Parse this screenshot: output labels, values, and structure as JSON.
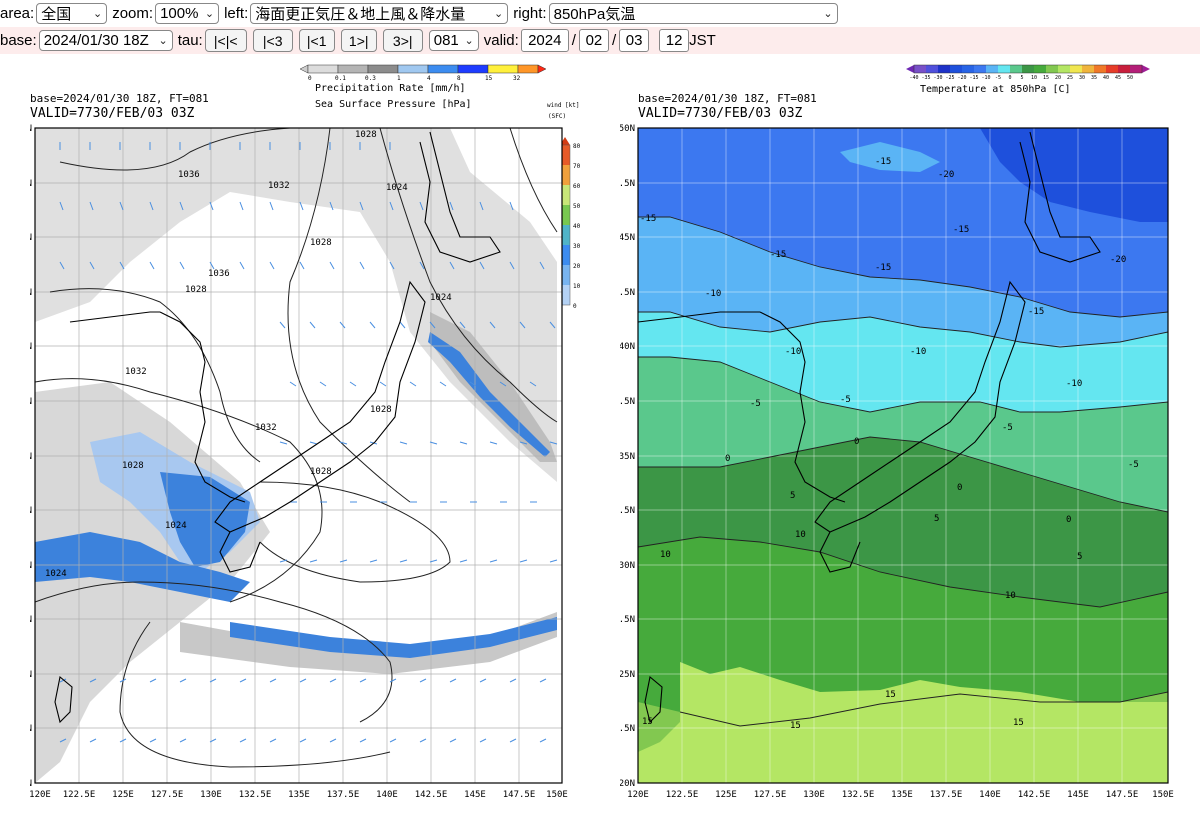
{
  "toolbar": {
    "area_label": "area:",
    "area_value": "全国",
    "zoom_label": "zoom:",
    "zoom_value": "100%",
    "left_label": "left:",
    "left_value": "海面更正気圧＆地上風＆降水量",
    "right_label": "right:",
    "right_value": "850hPa気温"
  },
  "nav": {
    "base_label": "base:",
    "base_value": "2024/01/30 18Z",
    "tau_label": "tau:",
    "btn_first": "|<|<",
    "btn_back3": "|<3",
    "btn_back1": "|<1",
    "btn_fwd1": "1>|",
    "btn_fwd3": "3>|",
    "tau_value": "081",
    "valid_label": "valid:",
    "valid_year": "2024",
    "valid_month": "02",
    "valid_day": "03",
    "valid_hour": "12",
    "slash": "/",
    "jst_label": "JST"
  },
  "left_map": {
    "header_line1": "base=2024/01/30 18Z, FT=081",
    "header_line2": "VALID=7730/FEB/03 03Z",
    "legend_title1": "Precipitation Rate [mm/h]",
    "legend_title2": "Sea Surface Pressure [hPa]",
    "precip_ticks": [
      "0",
      "0.1",
      "0.3",
      "1",
      "4",
      "8",
      "15",
      "32"
    ],
    "wind_title1": "wind [kt]",
    "wind_title2": "(SFC)",
    "wind_ticks": [
      "80",
      "70",
      "60",
      "50",
      "40",
      "30",
      "20",
      "10",
      "0"
    ],
    "isobar_labels": [
      "1028",
      "1036",
      "1032",
      "1024",
      "1028",
      "1036",
      "1028",
      "1024",
      "1032",
      "1032",
      "1028",
      "1028",
      "1028",
      "1024",
      "1024"
    ],
    "colors": {
      "sea": "#e6e6e6",
      "precip_light": "#a8c8f0",
      "precip": "#3c82dc",
      "wind": "#4a8fe0"
    }
  },
  "right_map": {
    "header_line1": "base=2024/01/30 18Z, FT=081",
    "header_line2": "VALID=7730/FEB/03 03Z",
    "legend_title": "Temperature at 850hPa [C]",
    "legend_ticks": [
      "-40",
      "-35",
      "-30",
      "-25",
      "-20",
      "-15",
      "-10",
      "-5",
      "0",
      "5",
      "10",
      "15",
      "20",
      "25",
      "30",
      "35",
      "40",
      "45",
      "50"
    ],
    "contour_labels": [
      "-15",
      "-20",
      "-15",
      "-15",
      "-15",
      "-15",
      "-20",
      "-10",
      "-15",
      "-10",
      "-10",
      "-10",
      "-5",
      "-5",
      "-5",
      "-5",
      "0",
      "0",
      "0",
      "5",
      "5",
      "0",
      "10",
      "10",
      "5",
      "10",
      "15",
      "15",
      "15",
      "15"
    ],
    "colors": {
      "cold": "#1e50dc",
      "c15": "#3c78f0",
      "c10": "#5ab4f5",
      "c5": "#64e6f0",
      "c0": "#5ac88c",
      "w5": "#3c9646",
      "w10": "#46aa3c",
      "w15": "#82c850",
      "w20": "#b4e664"
    }
  },
  "axes": {
    "lon_ticks": [
      "120E",
      "122.5E",
      "125E",
      "127.5E",
      "130E",
      "132.5E",
      "135E",
      "137.5E",
      "140E",
      "142.5E",
      "145E",
      "147.5E",
      "150E"
    ],
    "lat_ticks": [
      "50N",
      "47.5N",
      "45N",
      "42.5N",
      "40N",
      "37.5N",
      "35N",
      "32.5N",
      "30N",
      "27.5N",
      "25N",
      "22.5N",
      "20N"
    ]
  }
}
